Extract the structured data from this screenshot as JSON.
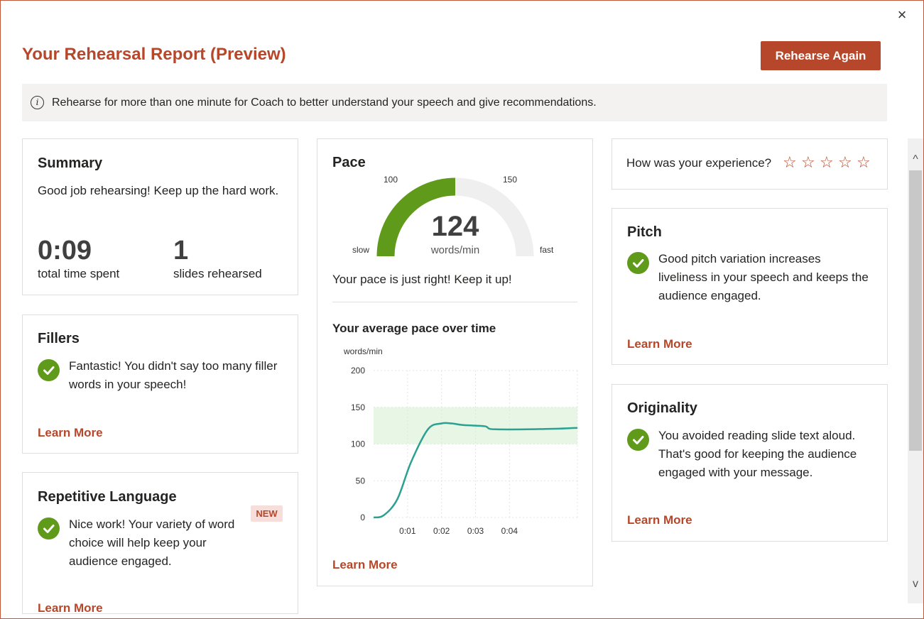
{
  "window": {
    "close_glyph": "×"
  },
  "header": {
    "title": "Your Rehearsal Report (Preview)",
    "rehearse_button": "Rehearse Again"
  },
  "info_bar": {
    "icon": "info-icon",
    "icon_glyph": "i",
    "message": "Rehearse for more than one minute for Coach to better understand your speech and give recommendations."
  },
  "summary": {
    "title": "Summary",
    "message": "Good job rehearsing! Keep up the hard work.",
    "total_time": "0:09",
    "total_time_label": "total time spent",
    "slides": "1",
    "slides_label": "slides rehearsed"
  },
  "fillers": {
    "title": "Fillers",
    "message": "Fantastic! You didn't say too many filler words in your speech!",
    "learn_more": "Learn More"
  },
  "repetitive": {
    "title": "Repetitive Language",
    "badge": "NEW",
    "message": "Nice work! Your variety of word choice will help keep your audience engaged.",
    "learn_more": "Learn More"
  },
  "pace": {
    "title": "Pace",
    "value": "124",
    "unit": "words/min",
    "gauge_min_label": "100",
    "gauge_max_label": "150",
    "slow_label": "slow",
    "fast_label": "fast",
    "message": "Your pace is just right! Keep it up!",
    "chart_title": "Your average pace over time",
    "learn_more": "Learn More"
  },
  "rating": {
    "question": "How was your experience?",
    "stars": [
      "☆",
      "☆",
      "☆",
      "☆",
      "☆"
    ],
    "selected": 0
  },
  "pitch": {
    "title": "Pitch",
    "message": "Good pitch variation increases liveliness in your speech and keeps the audience engaged.",
    "learn_more": "Learn More"
  },
  "originality": {
    "title": "Originality",
    "message": "You avoided reading slide text aloud. That's good for keeping the audience engaged with your message.",
    "learn_more": "Learn More"
  },
  "scrollbar": {
    "up_glyph": "^",
    "down_glyph": "v"
  },
  "colors": {
    "accent": "#b7472a",
    "gauge_fill": "#5f9a1a",
    "gauge_track": "#efefef",
    "line": "#2ba192",
    "band": "#e8f6e6",
    "check": "#5f9a1a"
  },
  "chart_data": {
    "type": "line",
    "title": "Your average pace over time",
    "ylabel": "words/min",
    "xlabel": "",
    "ylim": [
      0,
      200
    ],
    "yticks": [
      0,
      50,
      100,
      150,
      200
    ],
    "xticks": [
      {
        "v": 1,
        "label": "0:01"
      },
      {
        "v": 2,
        "label": "0:02"
      },
      {
        "v": 3,
        "label": "0:03"
      },
      {
        "v": 4,
        "label": "0:04"
      }
    ],
    "xlim": [
      0,
      6
    ],
    "target_band": [
      100,
      150
    ],
    "grid": true,
    "series": [
      {
        "x": [
          0,
          0.3,
          0.7,
          1.1,
          1.6,
          2.0,
          2.3,
          2.6,
          3.0,
          3.3,
          3.4,
          3.6,
          4.5,
          5.5,
          6.0
        ],
        "y": [
          0,
          3,
          25,
          75,
          120,
          128,
          128,
          126,
          125,
          124,
          121,
          120,
          120,
          121,
          122
        ]
      }
    ]
  }
}
